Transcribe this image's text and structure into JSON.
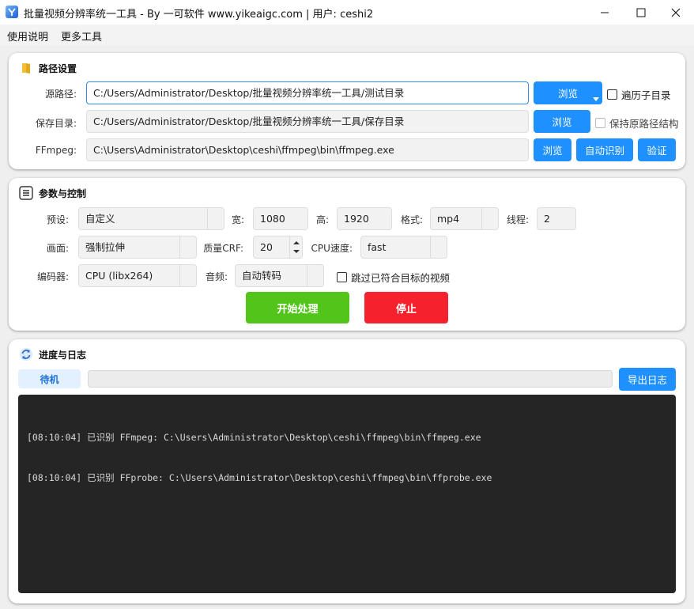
{
  "window": {
    "title": "批量视频分辨率统一工具 - By 一可软件 www.yikeaigc.com | 用户: ceshi2",
    "minimize": "minimize",
    "maximize": "maximize",
    "close": "close"
  },
  "menu": [
    "使用说明",
    "更多工具"
  ],
  "path_panel": {
    "title": "路径设置",
    "source_label": "源路径:",
    "source_value": "C:/Users/Administrator/Desktop/批量视频分辨率统一工具/测试目录",
    "browse_label": "浏览",
    "recurse_label": "遍历子目录",
    "save_label": "保存目录:",
    "save_value": "C:/Users/Administrator/Desktop/批量视频分辨率统一工具/保存目录",
    "keep_structure_label": "保持原路径结构",
    "ffmpeg_label": "FFmpeg:",
    "ffmpeg_value": "C:\\Users\\Administrator\\Desktop\\ceshi\\ffmpeg\\bin\\ffmpeg.exe",
    "auto_detect_label": "自动识别",
    "verify_label": "验证"
  },
  "params_panel": {
    "title": "参数与控制",
    "preset_label": "预设:",
    "preset_value": "自定义",
    "width_label": "宽:",
    "width_value": "1080",
    "height_label": "高:",
    "height_value": "1920",
    "format_label": "格式:",
    "format_value": "mp4",
    "threads_label": "线程:",
    "threads_value": "2",
    "frame_label": "画面:",
    "frame_value": "强制拉伸",
    "crf_label": "质量CRF:",
    "crf_value": "20",
    "cpu_speed_label": "CPU速度:",
    "cpu_speed_value": "fast",
    "encoder_label": "编码器:",
    "encoder_value": "CPU (libx264)",
    "audio_label": "音频:",
    "audio_value": "自动转码",
    "skip_label": "跳过已符合目标的视频",
    "start_label": "开始处理",
    "stop_label": "停止"
  },
  "log_panel": {
    "title": "进度与日志",
    "status": "待机",
    "progress": 0,
    "export_label": "导出日志",
    "lines": [
      "[08:10:04] 已识别 FFmpeg: C:\\Users\\Administrator\\Desktop\\ceshi\\ffmpeg\\bin\\ffmpeg.exe",
      "[08:10:04] 已识别 FFprobe: C:\\Users\\Administrator\\Desktop\\ceshi\\ffmpeg\\bin\\ffprobe.exe"
    ]
  },
  "colors": {
    "accent": "#1e90ff",
    "start": "#52c41a",
    "stop": "#f5222d",
    "log_bg": "#252525"
  },
  "icons": {
    "path_panel": "folder-icon",
    "params_panel": "list-icon",
    "log_panel": "refresh-icon"
  }
}
